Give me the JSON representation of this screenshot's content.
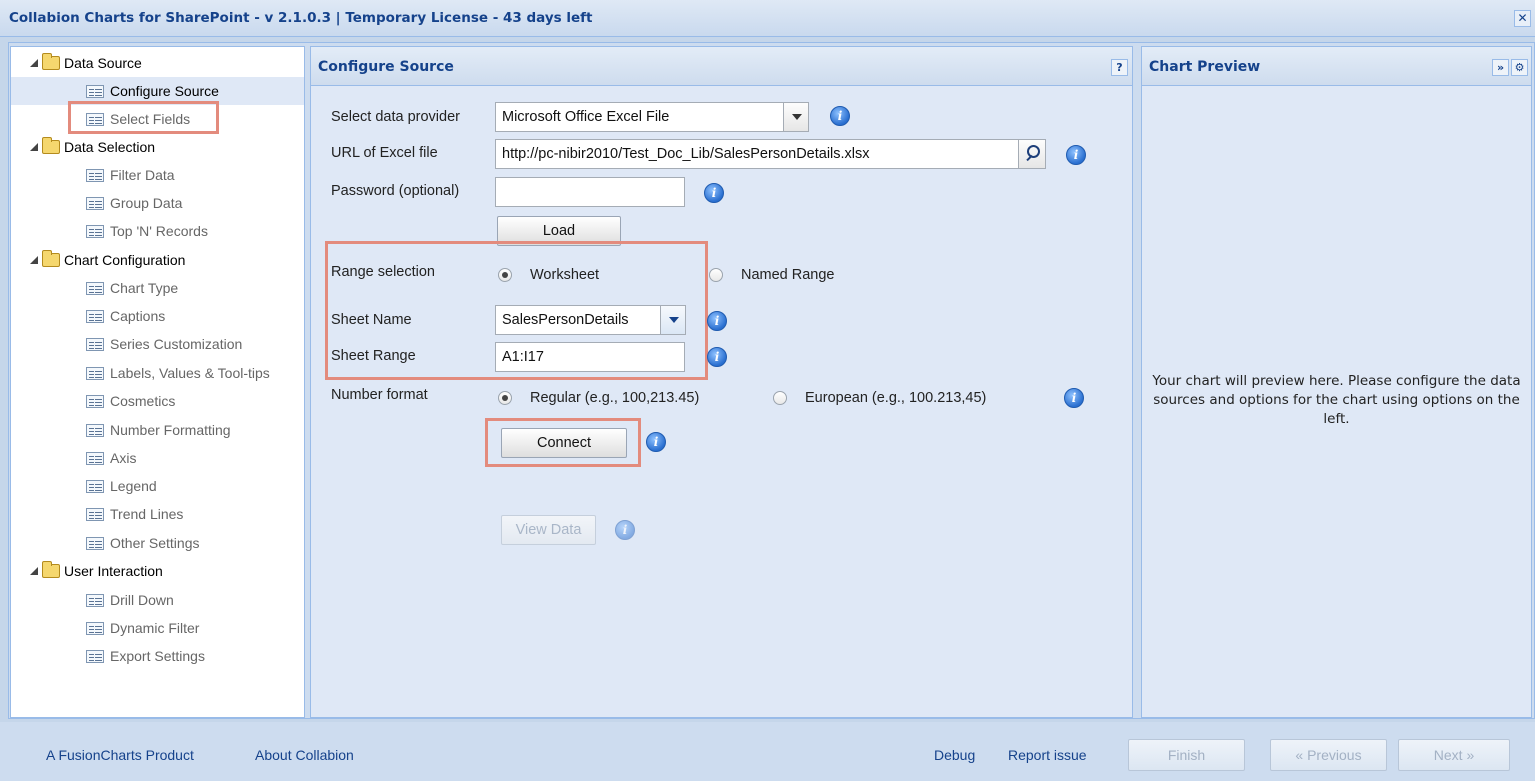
{
  "window": {
    "title": "Collabion Charts for SharePoint - v 2.1.0.3 | Temporary License - 43 days left",
    "close_glyph": "✕"
  },
  "tree": {
    "groups": [
      {
        "label": "Data Source",
        "items": [
          "Configure Source",
          "Select Fields"
        ]
      },
      {
        "label": "Data Selection",
        "items": [
          "Filter Data",
          "Group Data",
          "Top 'N' Records"
        ]
      },
      {
        "label": "Chart Configuration",
        "items": [
          "Chart Type",
          "Captions",
          "Series Customization",
          "Labels, Values & Tool-tips",
          "Cosmetics",
          "Number Formatting",
          "Axis",
          "Legend",
          "Trend Lines",
          "Other Settings"
        ]
      },
      {
        "label": "User Interaction",
        "items": [
          "Drill Down",
          "Dynamic Filter",
          "Export Settings"
        ]
      }
    ],
    "selected": "Configure Source"
  },
  "config": {
    "title": "Configure Source",
    "help_glyph": "?",
    "provider_label": "Select data provider",
    "provider_value": "Microsoft Office Excel File",
    "url_label": "URL of Excel file",
    "url_value": "http://pc-nibir2010/Test_Doc_Lib/SalesPersonDetails.xlsx",
    "password_label": "Password (optional)",
    "password_value": "",
    "load_label": "Load",
    "range_label": "Range selection",
    "range_worksheet": "Worksheet",
    "range_named": "Named Range",
    "sheet_name_label": "Sheet Name",
    "sheet_name_value": "SalesPersonDetails",
    "sheet_range_label": "Sheet Range",
    "sheet_range_value": "A1:I17",
    "number_format_label": "Number format",
    "number_regular": "Regular (e.g., 100,213.45)",
    "number_european": "European (e.g., 100.213,45)",
    "connect_label": "Connect",
    "view_data_label": "View Data",
    "info_glyph": "i"
  },
  "preview": {
    "title": "Chart Preview",
    "expand_glyph": "»",
    "gear_glyph": "⚙",
    "message": "Your chart will preview here. Please configure the data sources and options for the chart using options on the left."
  },
  "footer": {
    "fusioncharts_link": "A FusionCharts Product",
    "about_link": "About Collabion",
    "debug_link": "Debug",
    "report_link": "Report issue",
    "finish_label": "Finish",
    "previous_label": "« Previous",
    "next_label": "Next »"
  }
}
